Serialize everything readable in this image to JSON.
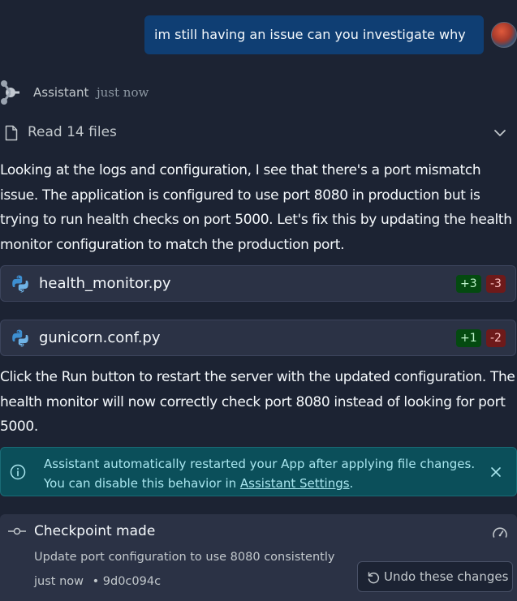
{
  "user_message": {
    "text": "im still having an issue can you investigate why"
  },
  "assistant": {
    "name": "Assistant",
    "time": "just now",
    "files_read_label": "Read 14 files",
    "paragraph1": "Looking at the logs and configuration, I see that there's a port mismatch issue. The application is configured to use port 8080 in production but is trying to run health checks on port 5000. Let's fix this by updating the health monitor configuration to match the production port.",
    "paragraph2": "Click the Run button to restart the server with the updated configuration. The health monitor will now correctly check port 8080 instead of looking for port 5000."
  },
  "file_changes": [
    {
      "name": "health_monitor.py",
      "added": "+3",
      "removed": "-3",
      "icon": "python-icon"
    },
    {
      "name": "gunicorn.conf.py",
      "added": "+1",
      "removed": "-2",
      "icon": "python-icon"
    }
  ],
  "info_banner": {
    "line1": "Assistant automatically restarted your App after applying file changes.",
    "line2_prefix": "You can disable this behavior in ",
    "line2_link": "Assistant Settings",
    "line2_suffix": "."
  },
  "checkpoint": {
    "title": "Checkpoint made",
    "description": "Update port configuration to use 8080 consistently",
    "time": "just now",
    "separator": "•",
    "commit": "9d0c094c",
    "undo_label": "Undo these changes"
  },
  "colors": {
    "background": "#1c2333",
    "card": "#2b3245",
    "user_bubble": "#0f3e73",
    "info_banner": "#0b4f5a",
    "diff_add_bg": "#044a10",
    "diff_del_bg": "#6e1a1a"
  }
}
